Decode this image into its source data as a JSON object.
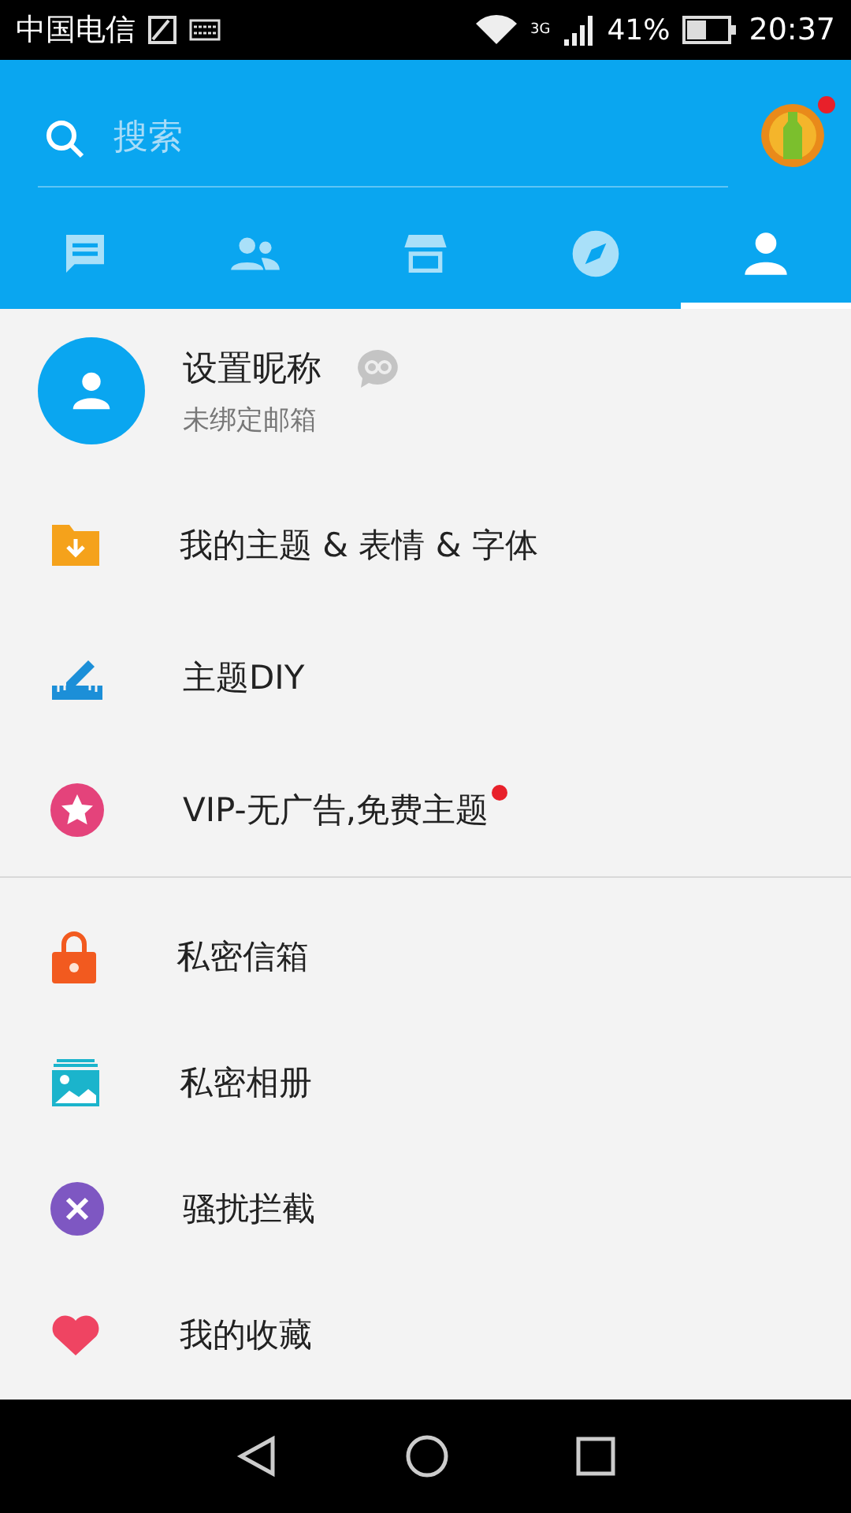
{
  "status_bar": {
    "carrier": "中国电信",
    "network": "3G",
    "battery": "41%",
    "time": "20:37"
  },
  "search": {
    "placeholder": "搜索",
    "avatar_dot": true
  },
  "tabs": [
    {
      "selected": false
    },
    {
      "selected": false
    },
    {
      "selected": false
    },
    {
      "selected": false
    },
    {
      "selected": true
    }
  ],
  "profile": {
    "nickname": "设置昵称",
    "email": "未绑定邮箱"
  },
  "sections": [
    {
      "items": [
        {
          "label": "我的主题 & 表情 & 字体",
          "dot": false
        },
        {
          "label": "主题DIY",
          "dot": false
        },
        {
          "label": "VIP-无广告,免费主题",
          "dot": true
        }
      ]
    },
    {
      "items": [
        {
          "label": "私密信箱",
          "dot": false
        },
        {
          "label": "私密相册",
          "dot": false
        },
        {
          "label": "骚扰拦截",
          "dot": false
        },
        {
          "label": "我的收藏",
          "dot": false
        }
      ]
    }
  ]
}
